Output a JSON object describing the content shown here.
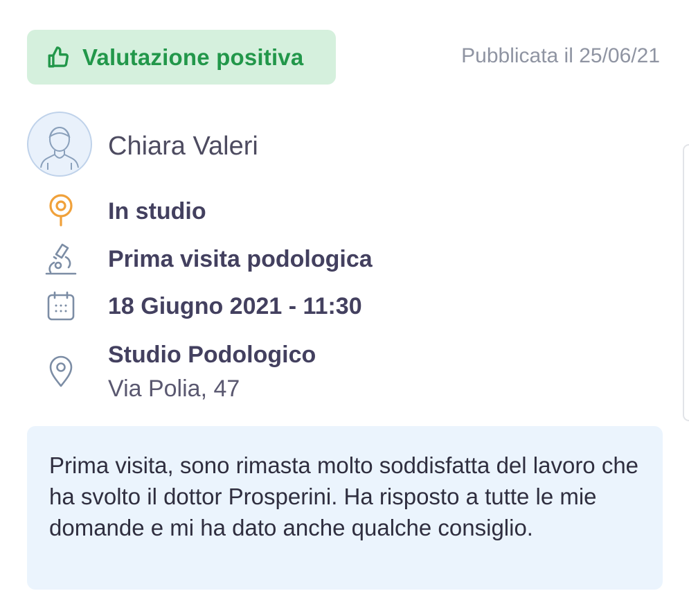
{
  "rating": {
    "label": "Valutazione positiva",
    "icon": "thumbs-up-icon",
    "color": "#22974a",
    "background": "#d5f0dd"
  },
  "published": "Pubblicata il 25/06/21",
  "reviewer": {
    "name": "Chiara Valeri",
    "avatar_icon": "user-avatar-icon"
  },
  "details": {
    "visit_mode": {
      "icon": "pin-icon",
      "text": "In studio",
      "color": "#f0a13a"
    },
    "service": {
      "icon": "microscope-icon",
      "text": "Prima visita podologica"
    },
    "date": {
      "icon": "calendar-icon",
      "text": "18 Giugno 2021 - 11:30"
    },
    "location": {
      "icon": "location-icon",
      "name": "Studio Podologico",
      "address": "Via Polia, 47"
    }
  },
  "review": {
    "text": "Prima visita, sono rimasta molto soddisfatta del lavoro che ha svolto il dottor Prosperini. Ha risposto a tutte le mie domande e mi ha dato anche qualche consiglio."
  }
}
